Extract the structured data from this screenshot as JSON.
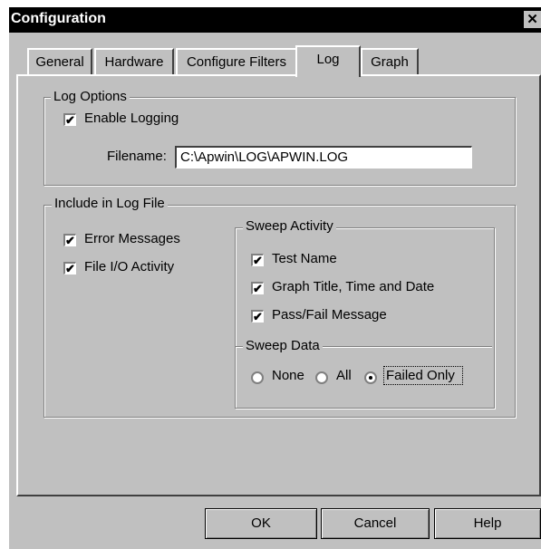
{
  "window": {
    "title": "Configuration",
    "close_glyph": "✕"
  },
  "tabs": [
    {
      "label": "General"
    },
    {
      "label": "Hardware"
    },
    {
      "label": "Configure Filters"
    },
    {
      "label": "Log",
      "active": true
    },
    {
      "label": "Graph"
    }
  ],
  "log_options": {
    "group_label": "Log Options",
    "enable_logging": {
      "label": "Enable Logging",
      "checked": true
    },
    "filename_label": "Filename:",
    "filename_value": "C:\\Apwin\\LOG\\APWIN.LOG"
  },
  "include": {
    "group_label": "Include in Log File",
    "error_messages": {
      "label": "Error Messages",
      "checked": true
    },
    "file_io": {
      "label": "File I/O Activity",
      "checked": true
    }
  },
  "sweep_activity": {
    "group_label": "Sweep Activity",
    "test_name": {
      "label": "Test Name",
      "checked": true
    },
    "graph_title": {
      "label": "Graph Title, Time and Date",
      "checked": true
    },
    "pass_fail": {
      "label": "Pass/Fail Message",
      "checked": true
    }
  },
  "sweep_data": {
    "group_label": "Sweep Data",
    "options": [
      {
        "label": "None",
        "selected": false
      },
      {
        "label": "All",
        "selected": false
      },
      {
        "label": "Failed Only",
        "selected": true
      }
    ]
  },
  "buttons": {
    "ok": "OK",
    "cancel": "Cancel",
    "help": "Help"
  },
  "check_glyph": "✔"
}
